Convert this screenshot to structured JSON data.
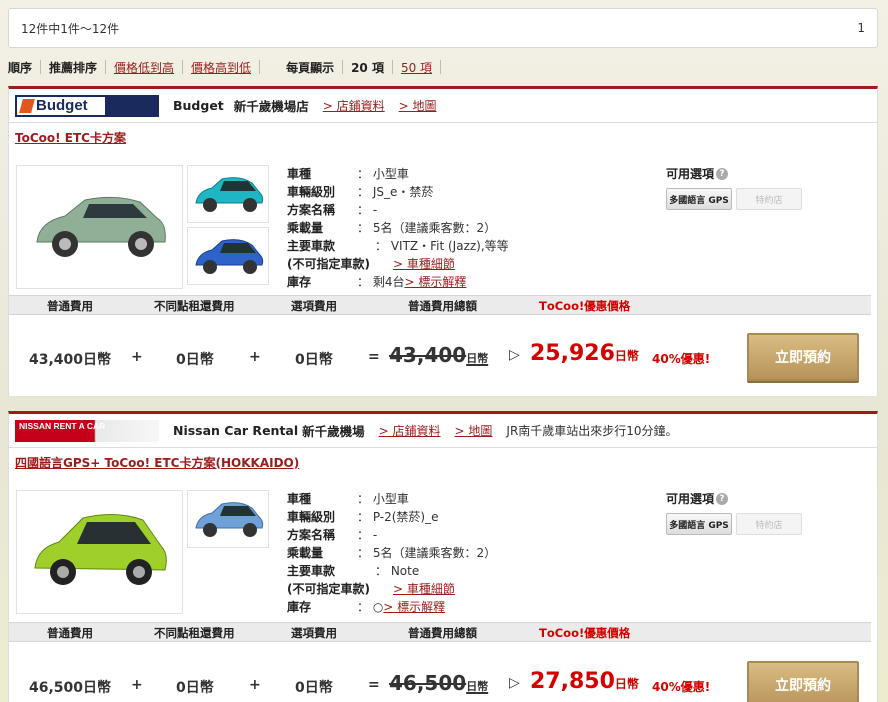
{
  "result_summary": "12件中1件～12件",
  "page_number": "1",
  "sort": {
    "order_label": "順序",
    "recommended": "推薦排序",
    "price_low": "價格低到高",
    "price_high": "價格高到低",
    "per_page_label": "每頁顯示",
    "per_page_current": "20 項",
    "per_page_alt": "50 項"
  },
  "labels": {
    "car_type": "車種",
    "car_class": "車輛級別",
    "plan_name": "方案名稱",
    "capacity": "乘載量",
    "main_model": "主要車款",
    "not_specified": "(不可指定車款)",
    "stock": "庫存",
    "available_options": "可用選項",
    "fee_normal": "普通費用",
    "fee_one_way": "不同點租還費用",
    "fee_option": "選項費用",
    "fee_total": "普通費用總額",
    "fee_tocoo": "TοCoo!優惠價格",
    "shop_info": "> 店鋪資料",
    "map": "> 地圖",
    "model_detail": "> 車種細節",
    "stock_explain": "> 標示解釋",
    "opt_gps": "多國語言 GPS",
    "opt_special": "特約店",
    "book": "立即預約",
    "plus": "+",
    "equals": "="
  },
  "listings": [
    {
      "company": "Budget",
      "logo_text": "Budget",
      "shop": "新千歲機場店",
      "note": "",
      "plan": "ToCoo! ETC卡方案",
      "car_type": "： 小型車",
      "car_class": "： JS_e・禁菸",
      "plan_name": "： -",
      "capacity": "： 5名（建議乘客數：2）",
      "main_model": "： VITZ・Fit (Jazz),等等",
      "stock": "： 剩4台",
      "fee_normal": "43,400日幣",
      "fee_one_way": "0日幣",
      "fee_option": "0日幣",
      "total_num": "43,400",
      "currency": "日幣",
      "price": "25,926",
      "discount": "40%優惠!"
    },
    {
      "company": "Nissan Car Rental",
      "logo_text": "NISSAN RENT A CAR",
      "shop": "新千歲機場",
      "note": "JR南千歲車站出來步行10分鐘。",
      "plan": "四國語言GPS+ ToCoo! ETC卡方案(HOKKAIDO)",
      "car_type": "： 小型車",
      "car_class": "： P-2(禁菸)_e",
      "plan_name": "： -",
      "capacity": "： 5名（建議乘客數：2）",
      "main_model": "： Note",
      "stock": "： ○",
      "fee_normal": "46,500日幣",
      "fee_one_way": "0日幣",
      "fee_option": "0日幣",
      "total_num": "46,500",
      "currency": "日幣",
      "price": "27,850",
      "discount": "40%優惠!"
    }
  ],
  "colors": {
    "accent_red": "#9b1c1c",
    "price_red": "#d40000",
    "button_gold": "#c6a46c",
    "budget_navy": "#1b2a5c",
    "nissan_red": "#c4001a"
  }
}
